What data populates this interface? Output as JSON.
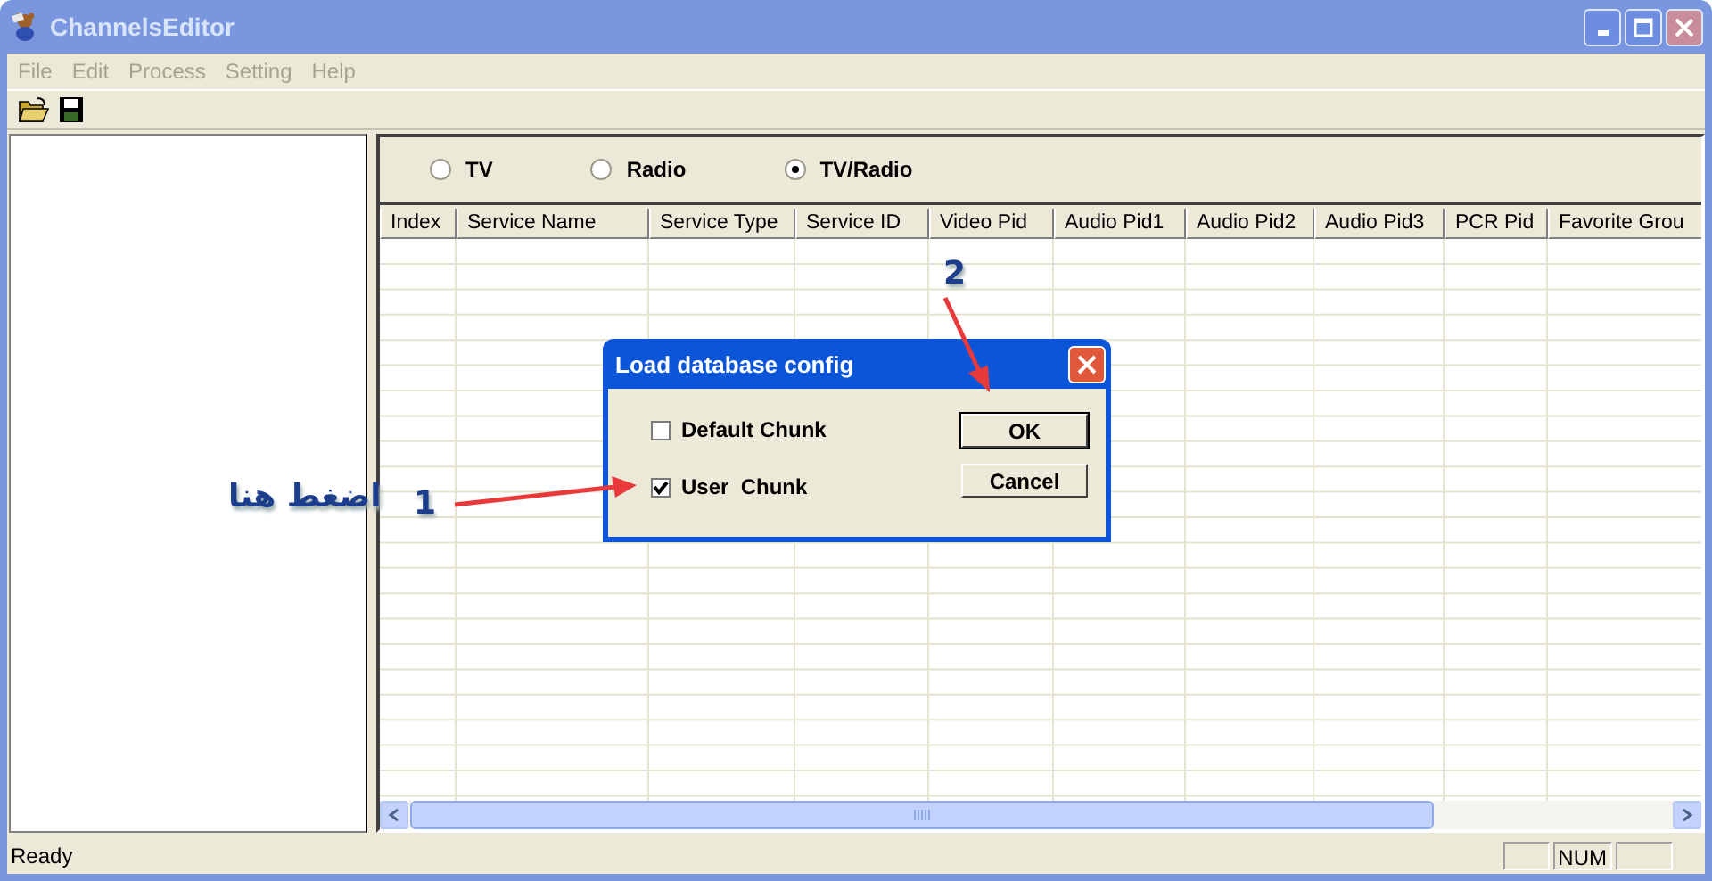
{
  "window": {
    "title": "ChannelsEditor"
  },
  "menu": [
    "File",
    "Edit",
    "Process",
    "Setting",
    "Help"
  ],
  "view_options": [
    {
      "label": "TV",
      "selected": false
    },
    {
      "label": "Radio",
      "selected": false
    },
    {
      "label": "TV/Radio",
      "selected": true
    }
  ],
  "table": {
    "columns": [
      "Index",
      "Service Name",
      "Service Type",
      "Service ID",
      "Video Pid",
      "Audio Pid1",
      "Audio Pid2",
      "Audio Pid3",
      "PCR Pid",
      "Favorite Grou"
    ]
  },
  "status_bar": {
    "text": "Ready",
    "indicator": "NUM"
  },
  "dialog": {
    "title": "Load database config",
    "options": [
      {
        "label": "Default Chunk",
        "checked": false
      },
      {
        "label": "User  Chunk",
        "checked": true
      }
    ],
    "buttons": [
      "OK",
      "Cancel"
    ]
  },
  "annotations": [
    {
      "number": "1",
      "text": "اضغط هنا"
    },
    {
      "number": "2"
    }
  ]
}
